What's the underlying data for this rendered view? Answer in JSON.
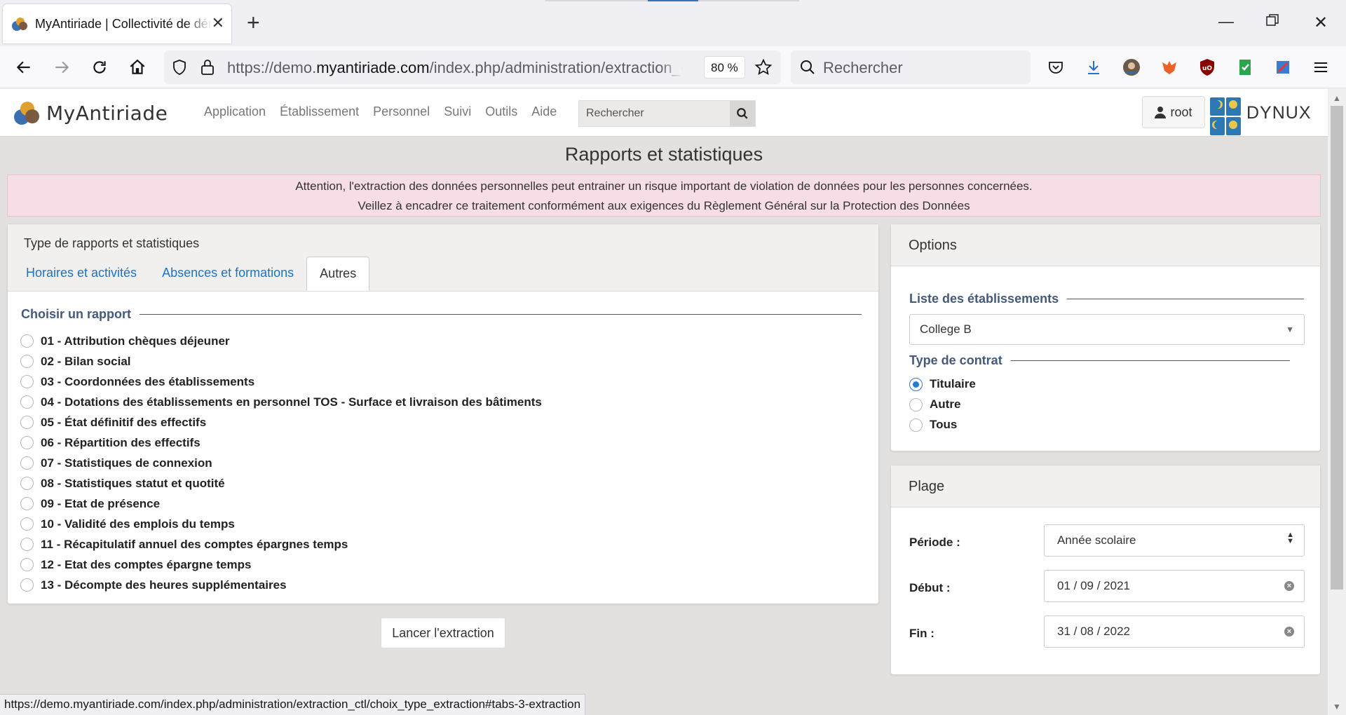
{
  "browser": {
    "tab_title": "MyAntiriade | Collectivité de démonstration",
    "url_prefix": "https://demo.",
    "url_domain": "myantiriade.com",
    "url_path": "/index.php/administration/extraction_ctl/choix_type_extraction",
    "zoom": "80 %",
    "search_placeholder": "Rechercher",
    "status_url": "https://demo.myantiriade.com/index.php/administration/extraction_ctl/choix_type_extraction#tabs-3-extraction"
  },
  "site": {
    "logo_text": "MyAntiriade",
    "menu": [
      "Application",
      "Établissement",
      "Personnel",
      "Suivi",
      "Outils",
      "Aide"
    ],
    "search_placeholder": "Rechercher",
    "user": "root",
    "partner_logo": "DYNUX"
  },
  "page": {
    "title": "Rapports et statistiques",
    "alert_line1": "Attention, l'extraction des données personnelles peut entrainer un risque important de violation de données pour les personnes concernées.",
    "alert_line2": "Veillez à encadrer ce traitement conformément aux exigences du Règlement Général sur la Protection des Données"
  },
  "reports_panel": {
    "heading": "Type de rapports et statistiques",
    "tabs": [
      "Horaires et activités",
      "Absences et formations",
      "Autres"
    ],
    "active_tab": "Autres",
    "legend": "Choisir un rapport",
    "reports": [
      "01 - Attribution chèques déjeuner",
      "02 - Bilan social",
      "03 - Coordonnées des établissements",
      "04 - Dotations des établissements en personnel TOS - Surface et livraison des bâtiments",
      "05 - État définitif des effectifs",
      "06 - Répartition des effectifs",
      "07 - Statistiques de connexion",
      "08 - Statistiques statut et quotité",
      "09 - Etat de présence",
      "10 - Validité des emplois du temps",
      "11 - Récapitulatif annuel des comptes épargnes temps",
      "12 - Etat des comptes épargne temps",
      "13 - Décompte des heures supplémentaires"
    ],
    "launch_button": "Lancer l'extraction"
  },
  "options_panel": {
    "heading": "Options",
    "etab_legend": "Liste des établissements",
    "etab_value": "College B",
    "contrat_legend": "Type de contrat",
    "contrat_options": [
      "Titulaire",
      "Autre",
      "Tous"
    ],
    "contrat_selected": "Titulaire"
  },
  "plage_panel": {
    "heading": "Plage",
    "periode_label": "Période :",
    "periode_value": "Année scolaire",
    "debut_label": "Début :",
    "debut_value": "01 / 09 / 2021",
    "fin_label": "Fin :",
    "fin_value": "31 / 08 / 2022"
  },
  "colors": {
    "link": "#1a73c9",
    "legend": "#455a7a",
    "alert_bg": "#f7dde6",
    "radio_checked": "#2a7bd3",
    "page_bg": "#e3e1df"
  }
}
